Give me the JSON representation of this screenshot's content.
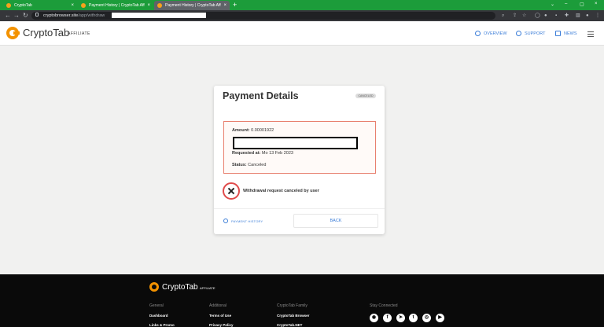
{
  "browser": {
    "tabs": [
      {
        "title": "CryptoTab",
        "close": "×"
      },
      {
        "title": "Payment History | CryptoTab Affili…",
        "close": "×"
      },
      {
        "title": "Payment History | CryptoTab Affi…",
        "close": "×"
      }
    ],
    "new_tab": "+",
    "window_controls": [
      "⌄",
      "–",
      "▢",
      "×"
    ],
    "nav": {
      "back": "←",
      "forward": "→",
      "reload": "↻"
    },
    "url_host": "cryptobrowser.site",
    "url_path": "/app/withdraw"
  },
  "header": {
    "brand": "CryptoTab",
    "brand_sub": "AFFILIATE",
    "nav": [
      {
        "label": "OVERVIEW"
      },
      {
        "label": "SUPPORT"
      },
      {
        "label": "NEWS"
      }
    ]
  },
  "payment": {
    "title": "Payment Details",
    "badge": "CANCELED",
    "amount_label": "Amount:",
    "amount_value": "0.00001922",
    "requested_label": "Requested at:",
    "requested_value": "Mo 13 Feb 2023",
    "status_label": "Status:",
    "status_value": "Canceled",
    "status_message": "Withdrawal request canceled by user",
    "history_link": "PAYMENT HISTORY",
    "back_button": "BACK"
  },
  "footer": {
    "brand": "CryptoTab",
    "brand_sub": "AFFILIATE",
    "columns": [
      {
        "heading": "General",
        "items": [
          "Dashboard",
          "Links & Promo"
        ]
      },
      {
        "heading": "Additional",
        "items": [
          "Terms of Use",
          "Privacy Policy"
        ]
      },
      {
        "heading": "CryptoTab Family",
        "items": [
          "CryptoTab Browser",
          "CryptoTab.NET"
        ]
      },
      {
        "heading": "Stay Connected",
        "items": []
      }
    ],
    "social": [
      {
        "icon": "discord-icon",
        "glyph": "◉"
      },
      {
        "icon": "facebook-icon",
        "glyph": "f"
      },
      {
        "icon": "telegram-icon",
        "glyph": "➤"
      },
      {
        "icon": "twitter-icon",
        "glyph": "t"
      },
      {
        "icon": "instagram-icon",
        "glyph": "◎"
      },
      {
        "icon": "youtube-icon",
        "glyph": "▶"
      }
    ]
  },
  "colors": {
    "tab_bar": "#1c9c3a",
    "brand_orange": "#f39200",
    "link_blue": "#3b7dd8",
    "alert_red": "#e04b4b"
  }
}
